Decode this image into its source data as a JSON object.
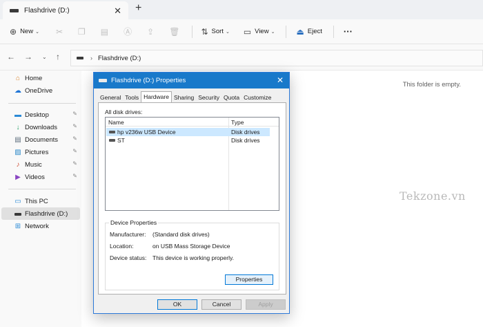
{
  "tab": {
    "title": "Flashdrive (D:)",
    "close_icon": "close-icon",
    "new_tab_icon": "plus-icon"
  },
  "toolbar": {
    "new_label": "New",
    "sort_label": "Sort",
    "view_label": "View",
    "eject_label": "Eject",
    "more_label": "···"
  },
  "address": {
    "location": "Flashdrive (D:)"
  },
  "sidebar": {
    "home": "Home",
    "onedrive": "OneDrive",
    "desktop": "Desktop",
    "downloads": "Downloads",
    "documents": "Documents",
    "pictures": "Pictures",
    "music": "Music",
    "videos": "Videos",
    "this_pc": "This PC",
    "flashdrive": "Flashdrive (D:)",
    "network": "Network"
  },
  "content": {
    "empty_text": "This folder is empty.",
    "watermark": "Tekzone.vn"
  },
  "dialog": {
    "title": "Flashdrive (D:) Properties",
    "tabs": [
      "General",
      "Tools",
      "Hardware",
      "Sharing",
      "Security",
      "Quota",
      "Customize"
    ],
    "selected_tab": "Hardware",
    "all_disk_drives_label": "All disk drives:",
    "columns": {
      "name": "Name",
      "type": "Type"
    },
    "drives": [
      {
        "name": "hp v236w USB Device",
        "type": "Disk drives"
      },
      {
        "name": "ST",
        "type": "Disk drives"
      }
    ],
    "device_properties": {
      "group_title": "Device Properties",
      "manufacturer_label": "Manufacturer:",
      "manufacturer_value": "(Standard disk drives)",
      "location_label": "Location:",
      "location_value": "on USB Mass Storage Device",
      "status_label": "Device status:",
      "status_value": "This device is working properly."
    },
    "properties_button": "Properties",
    "ok_button": "OK",
    "cancel_button": "Cancel",
    "apply_button": "Apply"
  },
  "colors": {
    "accent": "#1979ca",
    "selection": "#cce8ff"
  }
}
